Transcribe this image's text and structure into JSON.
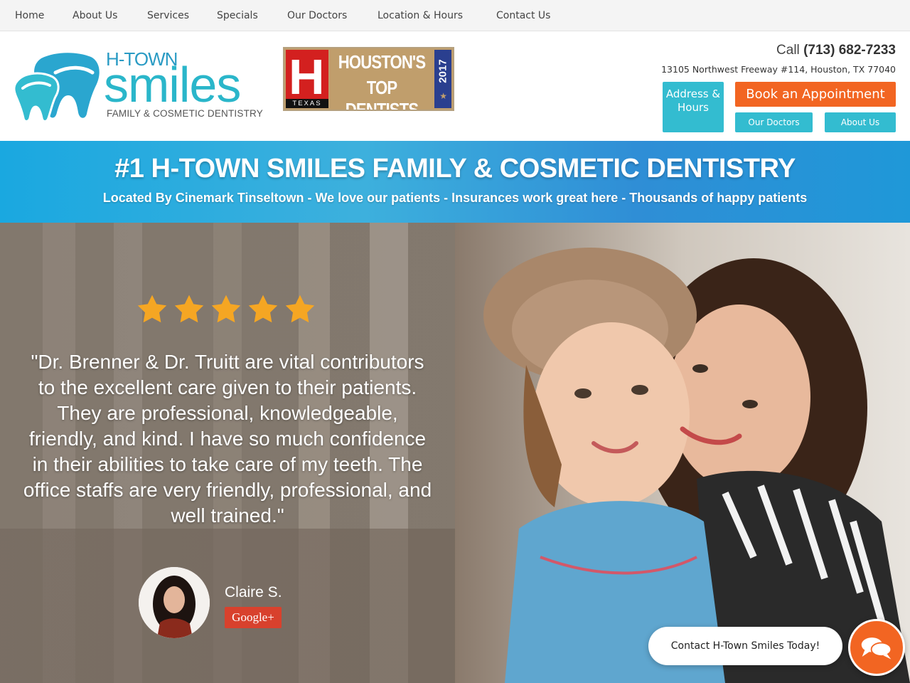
{
  "nav": {
    "items": [
      "Home",
      "About Us",
      "Services",
      "Specials",
      "Our Doctors",
      "Location & Hours",
      "Contact Us"
    ]
  },
  "header": {
    "logo": {
      "htown": "H-TOWN",
      "smiles": "smiles",
      "tagline": "FAMILY & COSMETIC DENTISTRY"
    },
    "badge": {
      "letter": "H",
      "state": "TEXAS",
      "line1": "HOUSTON'S",
      "line2": "TOP DENTISTS",
      "year": "2017"
    },
    "call_prefix": "Call",
    "phone": "(713) 682-7233",
    "address": "13105 Northwest Freeway #114, Houston, TX 77040",
    "buttons": {
      "address_hours": "Address & Hours",
      "book": "Book an Appointment",
      "doctors": "Our Doctors",
      "about": "About Us"
    }
  },
  "banner": {
    "title": "#1 H-TOWN SMILES FAMILY & COSMETIC DENTISTRY",
    "subtitle": "Located By Cinemark Tinseltown - We love our patients - Insurances work great here - Thousands of happy patients"
  },
  "testimonial": {
    "rating": 5,
    "quote": "\"Dr. Brenner & Dr. Truitt are vital contributors to the excellent care given to their patients. They are professional, knowledgeable, friendly, and kind. I have so much confidence in their abilities to take care of my teeth. The office staffs are very friendly, professional, and well trained.\"",
    "reviewer": "Claire S.",
    "source": "Google+"
  },
  "chat": {
    "prompt": "Contact H-Town Smiles Today!"
  },
  "colors": {
    "teal": "#33bcd0",
    "orange": "#f26522",
    "banner_blue": "#1aa8e0",
    "star": "#f5a623"
  }
}
